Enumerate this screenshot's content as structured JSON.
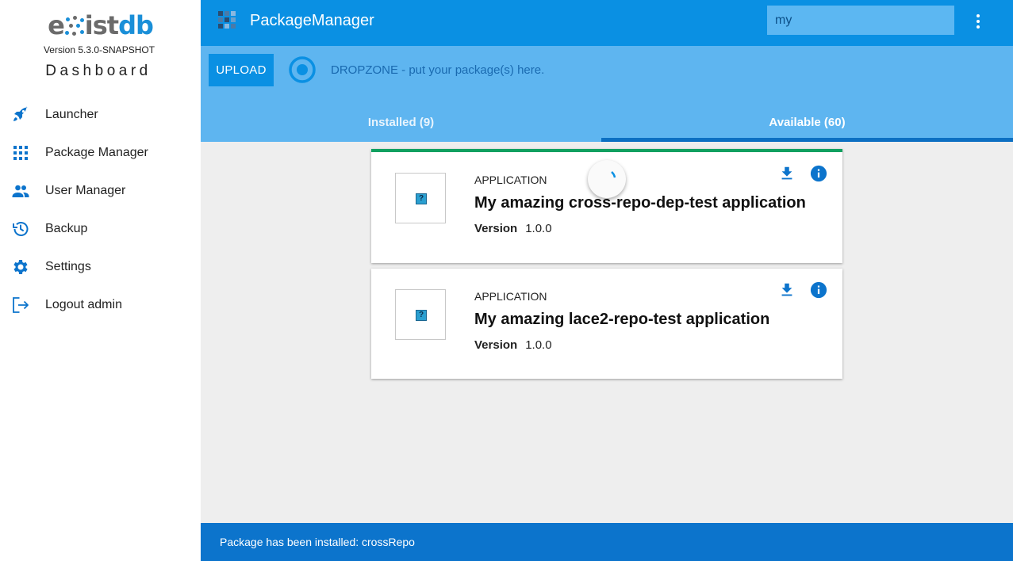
{
  "sidebar": {
    "logo_text": "existdb",
    "version": "Version 5.3.0-SNAPSHOT",
    "title": "Dashboard",
    "items": [
      {
        "label": "Launcher",
        "icon": "rocket-icon"
      },
      {
        "label": "Package Manager",
        "icon": "apps-grid-icon"
      },
      {
        "label": "User Manager",
        "icon": "people-icon"
      },
      {
        "label": "Backup",
        "icon": "history-icon"
      },
      {
        "label": "Settings",
        "icon": "gear-icon"
      },
      {
        "label": "Logout admin",
        "icon": "logout-icon"
      }
    ]
  },
  "header": {
    "title": "PackageManager",
    "search_value": "my",
    "more_icon": "more-vert-icon"
  },
  "toolbar": {
    "upload_label": "UPLOAD",
    "dropzone_text": "DROPZONE - put your package(s) here."
  },
  "tabs": [
    {
      "label": "Installed (9)",
      "active": false
    },
    {
      "label": "Available (60)",
      "active": true
    }
  ],
  "packages": [
    {
      "type": "APPLICATION",
      "title": "My amazing cross-repo-dep-test application",
      "version_label": "Version",
      "version": "1.0.0",
      "loading": true
    },
    {
      "type": "APPLICATION",
      "title": "My amazing lace2-repo-test application",
      "version_label": "Version",
      "version": "1.0.0",
      "loading": false
    }
  ],
  "toast": {
    "message": "Package has been installed: crossRepo"
  },
  "colors": {
    "primary": "#0a90e3",
    "toolbar": "#5eb5f0",
    "accent_bar": "#10a060",
    "icon_blue": "#0c74cc"
  }
}
